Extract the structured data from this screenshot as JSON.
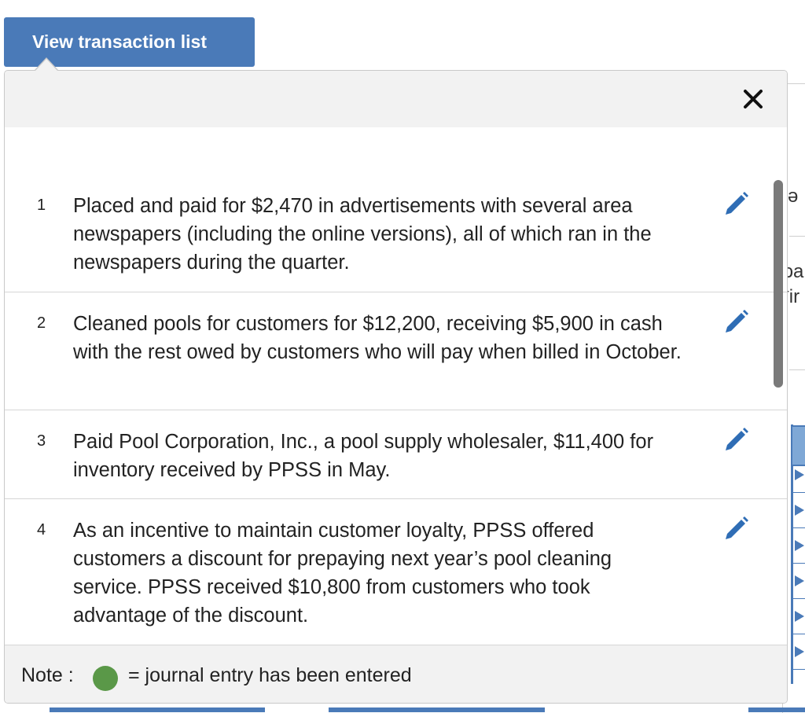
{
  "view_button_label": "View transaction list",
  "background_fragments": {
    "t1": "ə",
    "t2": "ɔa",
    "t3": "ʳir"
  },
  "popup": {
    "close_icon": "close-icon",
    "transactions": [
      {
        "num": "1",
        "text": "Placed and paid for $2,470 in advertisements with several area newspapers (including the online versions), all of which ran in the newspapers during the quarter."
      },
      {
        "num": "2",
        "text": "Cleaned pools for customers for $12,200, receiving $5,900 in cash with the rest owed by customers who will pay when billed in October."
      },
      {
        "num": "3",
        "text": "Paid Pool Corporation, Inc., a pool supply wholesaler, $11,400 for inventory received by PPSS in May."
      },
      {
        "num": "4",
        "text": "As an incentive to maintain customer loyalty, PPSS offered customers a discount for prepaying next year’s pool cleaning service. PPSS received $10,800 from customers who took advantage of the discount."
      }
    ],
    "edit_icon": "pencil-icon",
    "footer": {
      "note_label": "Note :",
      "note_text": "= journal entry has been entered",
      "dot_color": "#5a9848"
    }
  },
  "colors": {
    "accent": "#4a7ab8",
    "header_bg": "#f2f2f2"
  }
}
